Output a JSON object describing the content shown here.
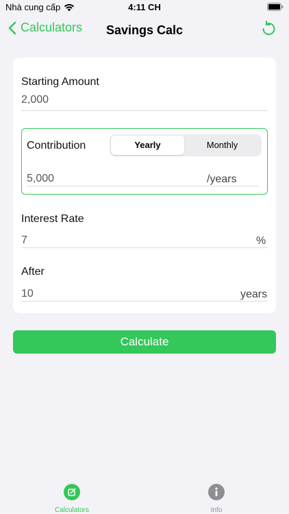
{
  "status_bar": {
    "carrier": "Nhà cung cấp",
    "time": "4:11 CH"
  },
  "nav": {
    "back_label": "Calculators",
    "title": "Savings Calc"
  },
  "form": {
    "starting_amount": {
      "label": "Starting Amount",
      "value": "2,000"
    },
    "contribution": {
      "label": "Contribution",
      "segments": [
        "Yearly",
        "Monthly"
      ],
      "selected": "Yearly",
      "value": "5,000",
      "unit": "/years"
    },
    "interest_rate": {
      "label": "Interest Rate",
      "value": "7",
      "unit": "%"
    },
    "after": {
      "label": "After",
      "value": "10",
      "unit": "years"
    }
  },
  "calculate_label": "Calculate",
  "tabs": [
    {
      "label": "Calculators",
      "icon": "edit-square-icon",
      "active": true
    },
    {
      "label": "Info",
      "icon": "info-circle-icon",
      "active": false
    }
  ],
  "colors": {
    "accent": "#34c759",
    "background": "#f2f2f7",
    "card": "#ffffff",
    "inactive": "#8e8e93"
  }
}
